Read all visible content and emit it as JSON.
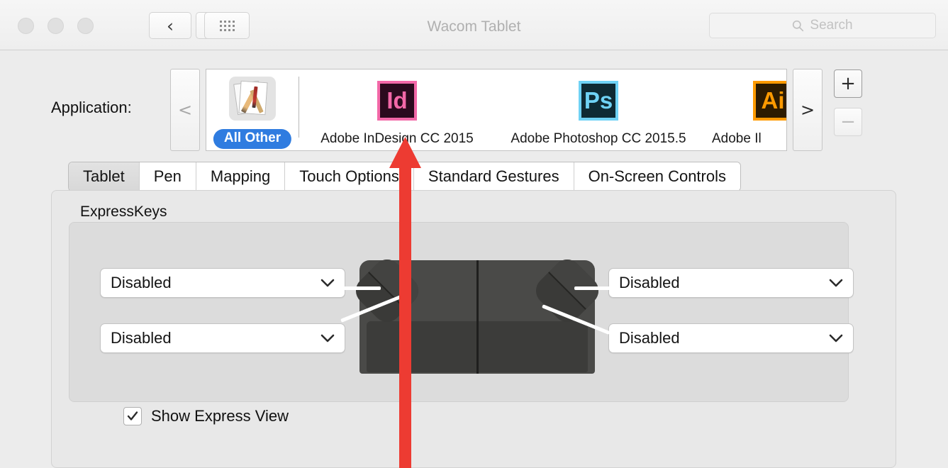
{
  "window": {
    "title": "Wacom Tablet",
    "traffic_lights": [
      "close",
      "minimize",
      "zoom"
    ],
    "nav_back_label": "‹",
    "nav_forward_label": "›",
    "grid_button_name": "show-all-preferences"
  },
  "search": {
    "placeholder": "Search",
    "value": ""
  },
  "application_row": {
    "label": "Application:",
    "scroll_left_label": "<",
    "scroll_right_label": ">",
    "add_label": "+",
    "remove_label": "−",
    "items": [
      {
        "name": "All Other",
        "badge": "All Other",
        "icon": "applications-folder-icon",
        "selected": true
      },
      {
        "name": "Adobe InDesign CC 2015",
        "icon": "indesign-icon",
        "glyph": "Id",
        "bg": "#2B0A1E",
        "border": "#F368A8",
        "fg": "#F368A8",
        "selected": false
      },
      {
        "name": "Adobe Photoshop CC 2015.5",
        "icon": "photoshop-icon",
        "glyph": "Ps",
        "bg": "#0E2A34",
        "border": "#6FD2F5",
        "fg": "#6FD2F5",
        "selected": false
      },
      {
        "name": "Adobe Il",
        "icon": "illustrator-icon",
        "glyph": "Ai",
        "bg": "#2D1B00",
        "border": "#FF9A00",
        "fg": "#FF9A00",
        "selected": false,
        "truncated": true
      }
    ]
  },
  "tabs": [
    {
      "label": "Tablet",
      "selected": true
    },
    {
      "label": "Pen",
      "selected": false
    },
    {
      "label": "Mapping",
      "selected": false
    },
    {
      "label": "Touch Options",
      "selected": false
    },
    {
      "label": "Standard Gestures",
      "selected": false
    },
    {
      "label": "On-Screen Controls",
      "selected": false
    }
  ],
  "panel": {
    "group_label": "ExpressKeys",
    "dropdowns": [
      {
        "position": "top-left",
        "value": "Disabled"
      },
      {
        "position": "bottom-left",
        "value": "Disabled"
      },
      {
        "position": "top-right",
        "value": "Disabled"
      },
      {
        "position": "bottom-right",
        "value": "Disabled"
      }
    ],
    "checkbox": {
      "label": "Show Express View",
      "checked": true
    },
    "tablet_illustration": "wacom-tablet-diagram"
  },
  "annotation": {
    "type": "arrow",
    "color": "#ED3B32",
    "points_to": "Adobe InDesign CC 2015"
  }
}
